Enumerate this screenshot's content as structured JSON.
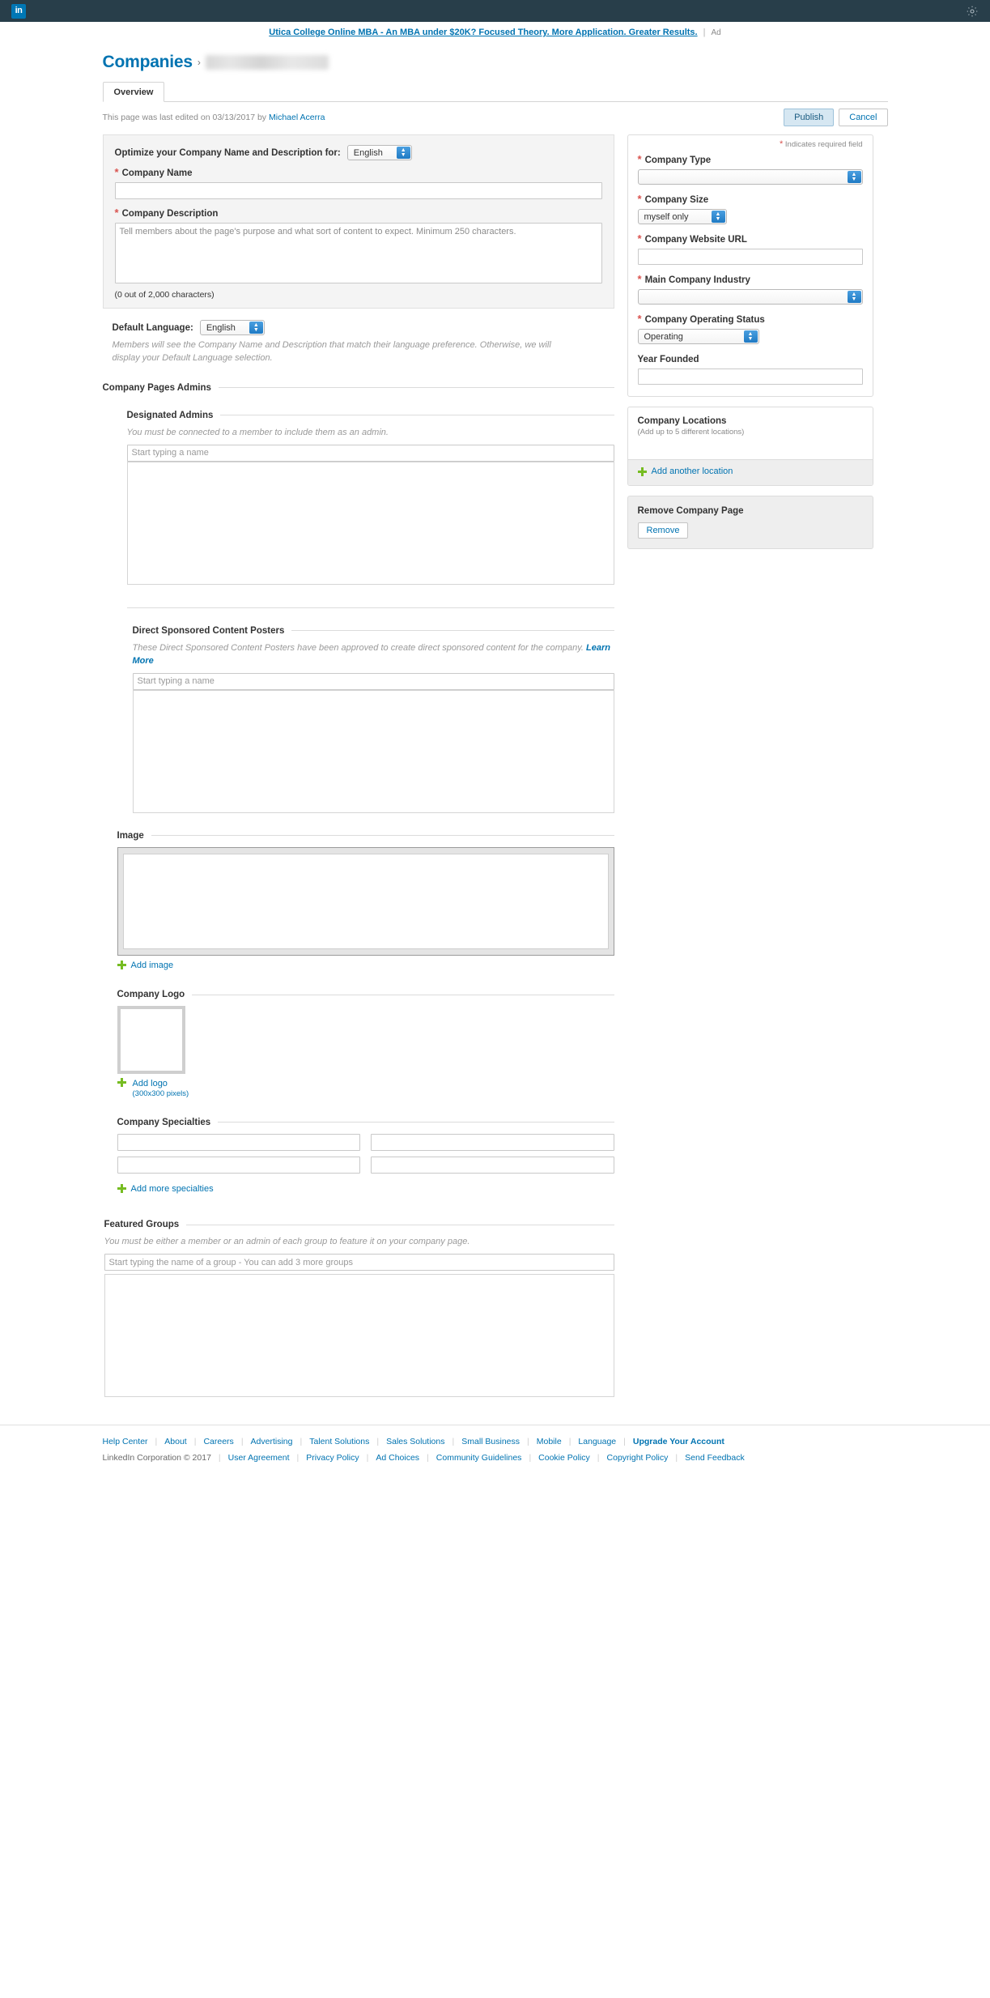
{
  "topbar": {
    "logo_text": "in",
    "settings_icon": "gear-icon"
  },
  "ad": {
    "text": "Utica College Online MBA - An MBA under $20K? Focused Theory. More Application. Greater Results.",
    "separator": "|",
    "tag": "Ad"
  },
  "breadcrumb": {
    "root": "Companies",
    "arrow": "›",
    "company": ""
  },
  "tabs": [
    {
      "label": "Overview",
      "active": true
    }
  ],
  "meta": {
    "prefix": "This page was last edited on 03/13/2017 by ",
    "editor": "Michael Acerra",
    "publish_label": "Publish",
    "cancel_label": "Cancel"
  },
  "optimize": {
    "heading": "Optimize your Company Name and Description for:",
    "language_selected": "English",
    "company_name": {
      "label": "Company Name",
      "required": true,
      "value": "",
      "placeholder": ""
    },
    "company_description": {
      "label": "Company Description",
      "required": true,
      "value": "",
      "placeholder": "Tell members about the page's purpose and what sort of content to expect. Minimum 250 characters.",
      "char_count": "(0 out of 2,000 characters)"
    }
  },
  "default_language": {
    "label": "Default Language:",
    "selected": "English",
    "note": "Members will see the Company Name and Description that match their language preference. Otherwise, we will display your Default Language selection."
  },
  "admins": {
    "section_title": "Company Pages Admins",
    "designated": {
      "title": "Designated Admins",
      "note": "You must be connected to a member to include them as an admin.",
      "placeholder": "Start typing a name",
      "value": ""
    },
    "sponsored": {
      "title": "Direct Sponsored Content Posters",
      "note": "These Direct Sponsored Content Posters have been approved to create direct sponsored content for the company. ",
      "note_link": "Learn More",
      "placeholder": "Start typing a name",
      "value": ""
    }
  },
  "image_section": {
    "title": "Image",
    "add_label": "Add image",
    "add_icon": "plus-icon"
  },
  "logo_section": {
    "title": "Company Logo",
    "add_label": "Add logo",
    "add_sub": "(300x300 pixels)",
    "add_icon": "plus-icon"
  },
  "specialties": {
    "title": "Company Specialties",
    "fields": [
      "",
      "",
      "",
      ""
    ],
    "add_label": "Add more specialties",
    "add_icon": "plus-icon"
  },
  "featured_groups": {
    "title": "Featured Groups",
    "note": "You must be either a member or an admin of each group to feature it on your company page.",
    "placeholder": "Start typing the name of a group - You can add 3 more groups",
    "value": ""
  },
  "right_rail": {
    "required_note": "Indicates required field",
    "required_marker": "*",
    "fields": [
      {
        "label": "Company Type",
        "required": true,
        "type": "select",
        "value": ""
      },
      {
        "label": "Company Size",
        "required": true,
        "type": "select",
        "value": "myself only"
      },
      {
        "label": "Company Website URL",
        "required": true,
        "type": "text",
        "value": ""
      },
      {
        "label": "Main Company Industry",
        "required": true,
        "type": "select",
        "value": ""
      },
      {
        "label": "Company Operating Status",
        "required": true,
        "type": "select",
        "value": "Operating"
      },
      {
        "label": "Year Founded",
        "required": false,
        "type": "text",
        "value": ""
      }
    ],
    "locations": {
      "title": "Company Locations",
      "subtitle": "(Add up to 5 different locations)",
      "add_label": "Add another location",
      "add_icon": "plus-icon"
    },
    "remove": {
      "title": "Remove Company Page",
      "button_label": "Remove"
    }
  },
  "footer": {
    "row1": [
      "Help Center",
      "About",
      "Careers",
      "Advertising",
      "Talent Solutions",
      "Sales Solutions",
      "Small Business",
      "Mobile",
      "Language",
      "Upgrade Your Account"
    ],
    "copyright": "LinkedIn Corporation © 2017",
    "row2": [
      "User Agreement",
      "Privacy Policy",
      "Ad Choices",
      "Community Guidelines",
      "Cookie Policy",
      "Copyright Policy",
      "Send Feedback"
    ]
  },
  "colors": {
    "brand": "#0073b1",
    "navbar": "#283e4a",
    "required": "#d9534f",
    "plus_green": "#76bc21"
  }
}
